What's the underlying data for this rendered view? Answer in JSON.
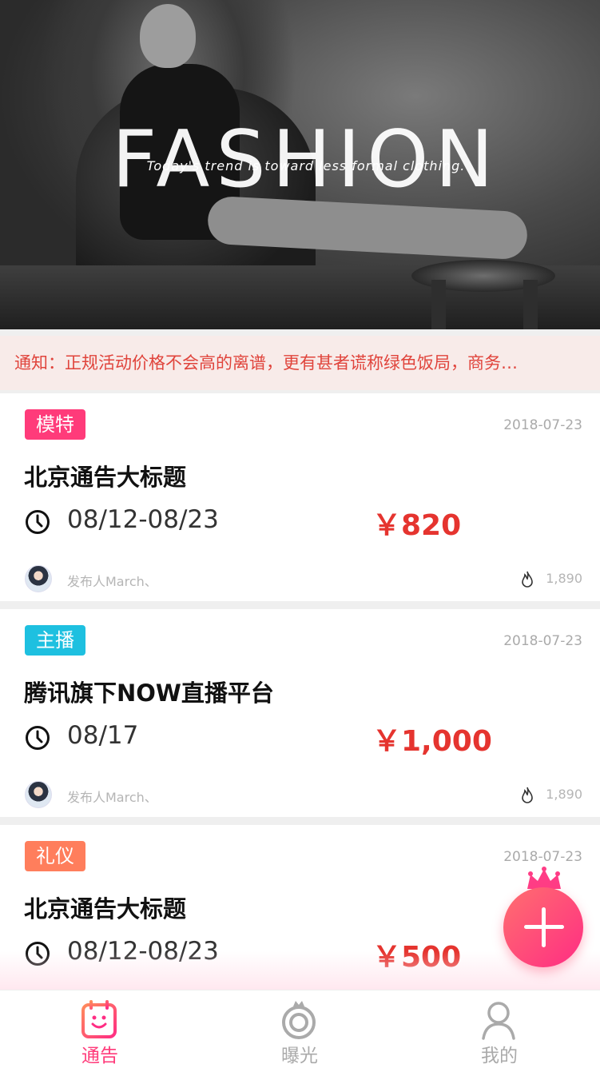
{
  "banner": {
    "title": "FASHION",
    "subtitle": "Today's trend is toward less formal clothing."
  },
  "notice": {
    "text": "通知：正规活动价格不会高的离谱，更有甚者谎称绿色饭局，商务…"
  },
  "cards": [
    {
      "tag": "模特",
      "tag_color": "#ff3b7a",
      "date": "2018-07-23",
      "title": "北京通告大标题",
      "time": "08/12-08/23",
      "price": "￥820",
      "publisher": "发布人March、",
      "views": "1,890"
    },
    {
      "tag": "主播",
      "tag_color": "#1ec0e0",
      "date": "2018-07-23",
      "title": "腾讯旗下NOW直播平台",
      "time": "08/17",
      "price": "￥1,000",
      "publisher": "发布人March、",
      "views": "1,890"
    },
    {
      "tag": "礼仪",
      "tag_color": "#ff7e5c",
      "date": "2018-07-23",
      "title": "北京通告大标题",
      "time": "08/12-08/23",
      "price": "￥500"
    }
  ],
  "fab": {
    "icon": "plus-icon"
  },
  "tabbar": {
    "items": [
      {
        "label": "通告",
        "icon": "notice-icon",
        "active": true,
        "color": "#ff3b7a"
      },
      {
        "label": "曝光",
        "icon": "exposure-icon",
        "active": false,
        "color": "#aaaaaa"
      },
      {
        "label": "我的",
        "icon": "profile-icon",
        "active": false,
        "color": "#aaaaaa"
      }
    ]
  }
}
